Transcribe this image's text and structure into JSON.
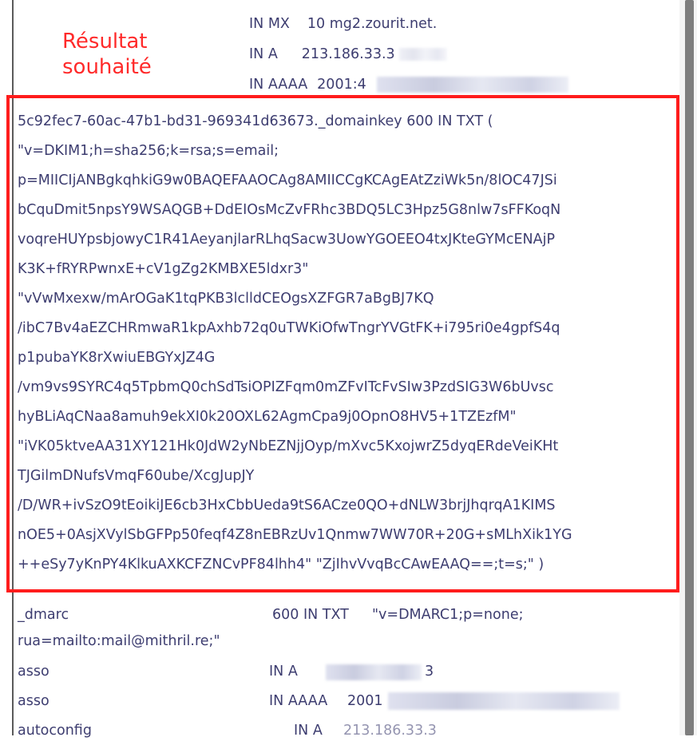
{
  "annotation": {
    "line1": "Résultat",
    "line2": "souhaité",
    "color": "#ff2a2a"
  },
  "top_records": [
    {
      "type": "IN MX",
      "value": "10 mg2.zourit.net."
    },
    {
      "type": "IN A",
      "value": "213.186.33.3"
    },
    {
      "type": "IN AAAA",
      "value": "2001:4"
    }
  ],
  "dkim_lines": [
    "5c92fec7-60ac-47b1-bd31-969341d63673._domainkey    600 IN TXT    (",
    "\"v=DKIM1;h=sha256;k=rsa;s=email;",
    "p=MIICIjANBgkqhkiG9w0BAQEFAAOCAg8AMIICCgKCAgEAtZziWk5n/8lOC47JSi",
    "bCquDmit5npsY9WSAQGB+DdEIOsMcZvFRhc3BDQ5LC3Hpz5G8nlw7sFFKoqN",
    "voqreHUYpsbjowyC1R41AeyanjlarRLhqSacw3UowYGOEEO4txJKteGYMcENAjP",
    "K3K+fRYRPwnxE+cV1gZg2KMBXE5ldxr3\"",
    "\"vVwMxexw/mArOGaK1tqPKB3lclldCEOgsXZFGR7aBgBJ7KQ",
    "/ibC7Bv4aEZCHRmwaR1kpAxhb72q0uTWKiOfwTngrYVGtFK+i795ri0e4gpfS4q",
    "p1pubaYK8rXwiuEBGYxJZ4G",
    "/vm9vs9SYRC4q5TpbmQ0chSdTsiOPIZFqm0mZFvITcFvSIw3PzdSIG3W6bUvsc",
    "hyBLiAqCNaa8amuh9ekXI0k20OXL62AgmCpa9j0OpnO8HV5+1TZEzfM\"",
    "\"iVK05ktveAA31XY121Hk0JdW2yNbEZNjjOyp/mXvc5KxojwrZ5dyqERdeVeiKHt",
    "TJGilmDNufsVmqF60ube/XcgJupJY",
    "/D/WR+ivSzO9tEoikiJE6cb3HxCbbUeda9tS6ACze0QO+dNLW3brjJhqrqA1KIMS",
    "nOE5+0AsjXVylSbGFPp50feqf4Z8nEBRzUv1Qnmw7WW70R+20G+sMLhXik1YG",
    "++eSy7yKnPY4KlkuAXKCFZNCvPF84lhh4\" \"ZjIhvVvqBcCAwEAAQ==;t=s;\" )"
  ],
  "dmarc": {
    "name": "_dmarc",
    "ttl_type": "600 IN TXT",
    "value": "\"v=DMARC1;p=none;",
    "value2": "rua=mailto:mail@mithril.re;\""
  },
  "bottom_records": [
    {
      "name": "asso",
      "type": "IN A",
      "value": "3"
    },
    {
      "name": "asso",
      "type": "IN AAAA",
      "value": "2001"
    },
    {
      "name": "autoconfig",
      "type": "IN A",
      "value": "213.186.33.3"
    }
  ],
  "colors": {
    "text": "#3d3d70",
    "highlight_border": "#ff1c1c"
  }
}
